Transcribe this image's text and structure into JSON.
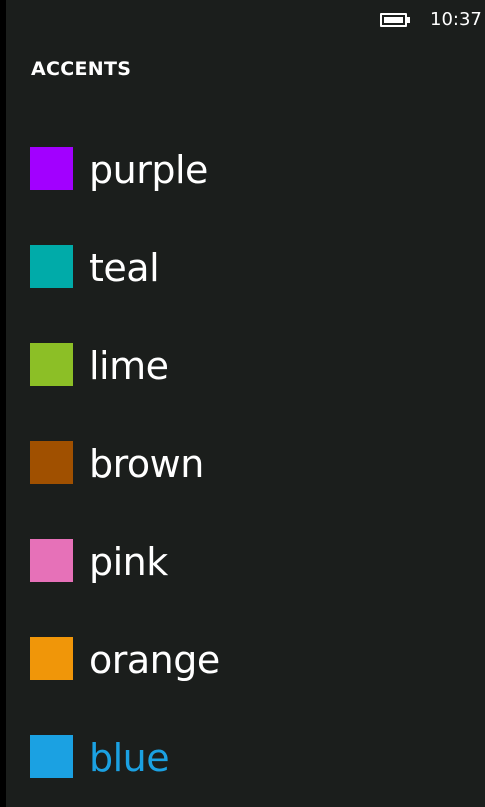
{
  "status_bar": {
    "time": "10:37",
    "battery_icon": "battery-icon"
  },
  "page": {
    "title": "ACCENTS"
  },
  "accents": [
    {
      "label": "purple",
      "color": "#a200ff",
      "selected": false
    },
    {
      "label": "teal",
      "color": "#00aba9",
      "selected": false
    },
    {
      "label": "lime",
      "color": "#8cbf26",
      "selected": false
    },
    {
      "label": "brown",
      "color": "#a05000",
      "selected": false
    },
    {
      "label": "pink",
      "color": "#e671b8",
      "selected": false
    },
    {
      "label": "orange",
      "color": "#f09609",
      "selected": false
    },
    {
      "label": "blue",
      "color": "#1ba1e2",
      "selected": true
    }
  ],
  "colors": {
    "background": "#1b1e1c",
    "text": "#ffffff",
    "selected_text": "#1ba1e2"
  }
}
